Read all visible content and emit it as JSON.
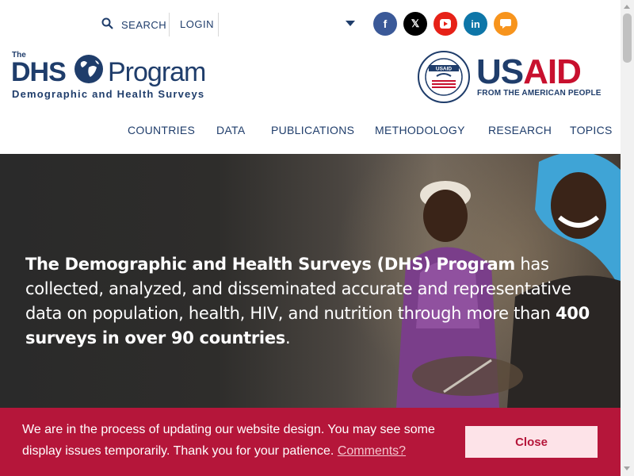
{
  "header": {
    "search_label": "SEARCH",
    "login_label": "LOGIN",
    "social": [
      {
        "name": "facebook",
        "glyph": "f",
        "color": "#3b5998"
      },
      {
        "name": "x",
        "glyph": "𝕏",
        "color": "#000000"
      },
      {
        "name": "youtube",
        "glyph": "▶",
        "color": "#e62117"
      },
      {
        "name": "linkedin",
        "glyph": "in",
        "color": "#0e76a8"
      },
      {
        "name": "chat",
        "glyph": "💬",
        "color": "#f7941d"
      }
    ]
  },
  "logos": {
    "dhs_the": "The",
    "dhs_word": "DHS",
    "dhs_program": "Program",
    "dhs_tagline": "Demographic and Health Surveys",
    "usaid_us": "US",
    "usaid_aid": "AID",
    "usaid_sub": "FROM THE AMERICAN PEOPLE",
    "usaid_seal_text": "USAID"
  },
  "nav": {
    "items": [
      "COUNTRIES",
      "DATA",
      "PUBLICATIONS",
      "METHODOLOGY",
      "RESEARCH",
      "TOPICS"
    ]
  },
  "hero": {
    "bold1": "The Demographic and Health Surveys (DHS) Program",
    "text1": " has collected, analyzed, and disseminated accurate and representative data on population, health, HIV, and nutrition through more than ",
    "bold2": "400 surveys in over 90 countries",
    "text2": "."
  },
  "cookie": {
    "message": "We are in the process of updating our website design. You may see some display issues temporarily. Thank you for your patience.",
    "link_label": "Comments?",
    "close_label": "Close"
  },
  "colors": {
    "brand_navy": "#1f3d6b",
    "usaid_red": "#c8102e",
    "banner_red": "#b5163a"
  }
}
